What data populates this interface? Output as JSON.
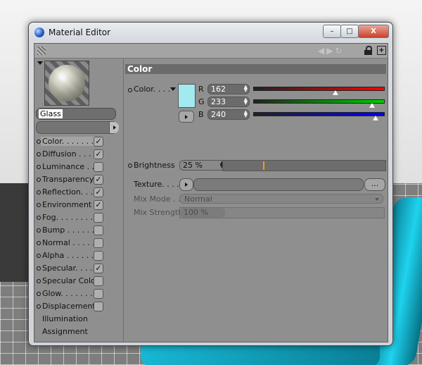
{
  "window": {
    "title": "Material Editor",
    "minimize": "–",
    "maximize": "□",
    "close": "X"
  },
  "material": {
    "name": "Glass"
  },
  "channels": [
    {
      "label": "Color. . . . . . . .",
      "checked": true,
      "selected": true
    },
    {
      "label": "Diffusion . . . . .",
      "checked": true
    },
    {
      "label": "Luminance . . . .",
      "checked": false
    },
    {
      "label": "Transparency",
      "checked": true
    },
    {
      "label": "Reflection. . . . .",
      "checked": true
    },
    {
      "label": "Environment",
      "checked": true
    },
    {
      "label": "Fog. . . . . . . . .",
      "checked": false
    },
    {
      "label": "Bump . . . . . . .",
      "checked": false
    },
    {
      "label": "Normal . . . . . .",
      "checked": false
    },
    {
      "label": "Alpha . . . . . . .",
      "checked": false
    },
    {
      "label": "Specular. . . . .",
      "checked": true
    },
    {
      "label": "Specular Color",
      "checked": false
    },
    {
      "label": "Glow. . . . . . . .",
      "checked": false
    },
    {
      "label": "Displacement",
      "checked": false
    }
  ],
  "extra_items": [
    "Illumination",
    "Assignment"
  ],
  "color_section": {
    "title": "Color",
    "color_label": "Color. . . .",
    "swatch_color": "#a2e9f0",
    "r_label": "R",
    "r_value": "162",
    "g_label": "G",
    "g_value": "233",
    "b_label": "B",
    "b_value": "240",
    "brightness_label": "Brightness",
    "brightness_value": "25 %",
    "brightness_fraction": 0.25,
    "texture_label": "Texture. . . .",
    "texture_button": "...",
    "mix_mode_label": "Mix Mode . .",
    "mix_mode_value": "Normal",
    "mix_strength_label": "Mix Strength",
    "mix_strength_value": "100 %"
  },
  "colors": {
    "red": "#ff0000",
    "green": "#00c800",
    "blue": "#0000ff",
    "highlight": "#ff9a00"
  },
  "checkmark": "✓"
}
